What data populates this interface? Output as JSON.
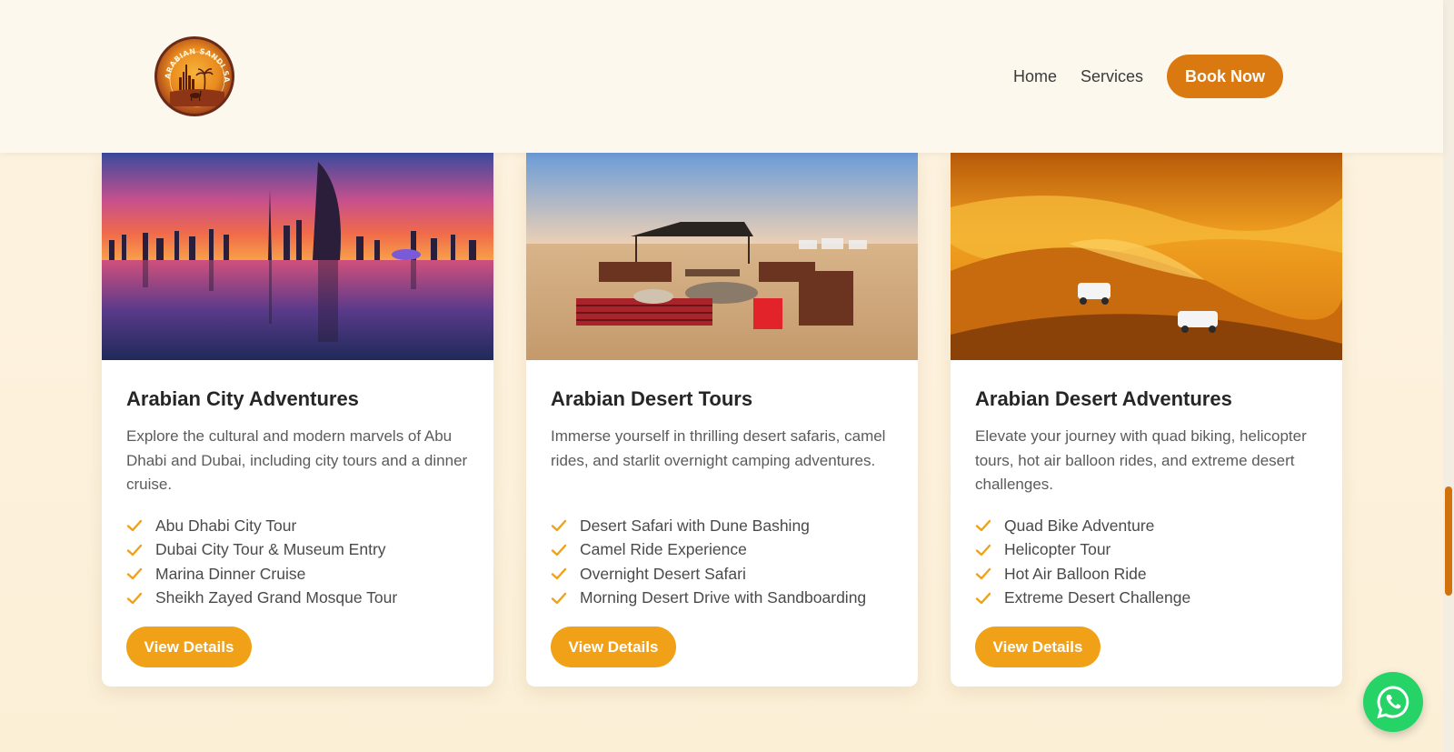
{
  "header": {
    "logo_text": "ARABIAN SANDI SAFARI",
    "nav": [
      {
        "label": "Home"
      },
      {
        "label": "Services"
      }
    ],
    "book_label": "Book Now"
  },
  "cards": [
    {
      "title": "Arabian City Adventures",
      "description": "Explore the cultural and modern marvels of Abu Dhabi and Dubai, including city tours and a dinner cruise.",
      "features": [
        "Abu Dhabi City Tour",
        "Dubai City Tour & Museum Entry",
        "Marina Dinner Cruise",
        "Sheikh Zayed Grand Mosque Tour"
      ],
      "button": "View Details"
    },
    {
      "title": "Arabian Desert Tours",
      "description": "Immerse yourself in thrilling desert safaris, camel rides, and starlit overnight camping adventures.",
      "features": [
        "Desert Safari with Dune Bashing",
        "Camel Ride Experience",
        "Overnight Desert Safari",
        "Morning Desert Drive with Sandboarding"
      ],
      "button": "View Details"
    },
    {
      "title": "Arabian Desert Adventures",
      "description": "Elevate your journey with quad biking, helicopter tours, hot air balloon rides, and extreme desert challenges.",
      "features": [
        "Quad Bike Adventure",
        "Helicopter Tour",
        "Hot Air Balloon Ride",
        "Extreme Desert Challenge"
      ],
      "button": "View Details"
    }
  ],
  "colors": {
    "accent": "#f0a117",
    "brand_dark": "#d9790f",
    "whatsapp": "#25d366"
  },
  "icons": {
    "check": "check-icon",
    "whatsapp": "whatsapp-icon"
  }
}
